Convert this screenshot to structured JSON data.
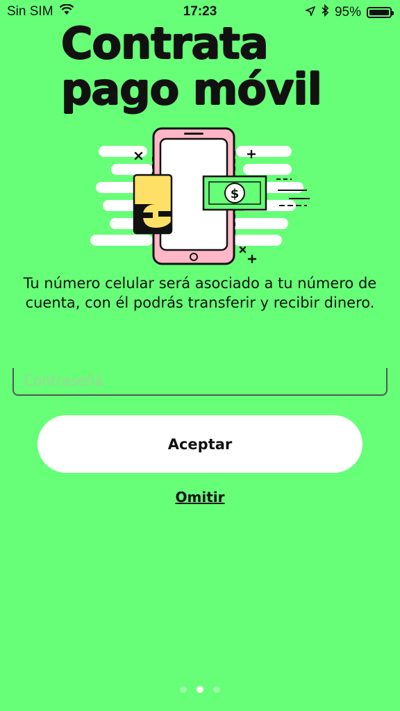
{
  "status_bar": {
    "carrier": "Sin SIM",
    "time": "17:23",
    "battery": "95%",
    "battery_level": 0.95,
    "icons": [
      "wifi-icon",
      "location-arrow-icon",
      "bluetooth-icon",
      "battery-icon"
    ]
  },
  "header": {
    "title_line1": "Contrata",
    "title_line2": "pago móvil"
  },
  "illustration": {
    "icons": [
      "phone-icon",
      "card-icon",
      "banknote-icon",
      "dollar-icon"
    ],
    "phone_color": "#ffb6c6",
    "card_color": "#ffe066",
    "banknote_color": "#66ff77"
  },
  "main": {
    "description": "Tu número celular será asociado a tu número de cuenta, con él podrás transferir y recibir dinero."
  },
  "form": {
    "password_placeholder": "Contraseña",
    "password_value": ""
  },
  "actions": {
    "accept_label": "Aceptar",
    "skip_label": "Omitir"
  },
  "pagination": {
    "total": 3,
    "current": 2
  },
  "colors": {
    "background": "#66ff77",
    "button_bg": "#ffffff",
    "text": "#111111"
  }
}
